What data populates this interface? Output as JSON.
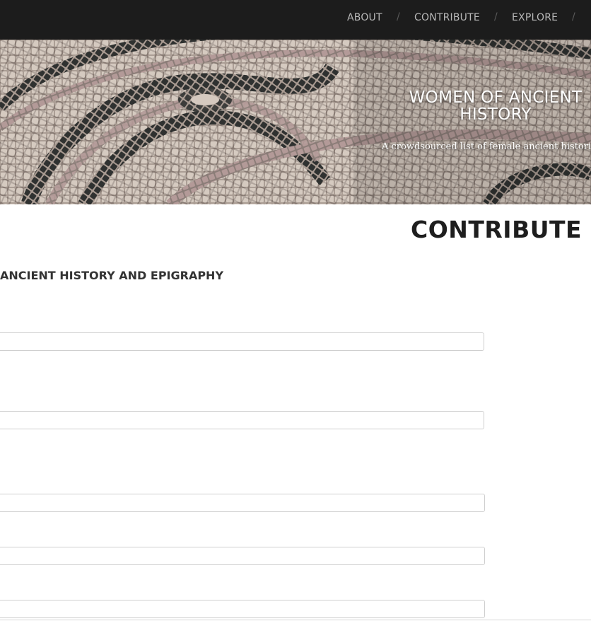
{
  "nav": {
    "items": [
      {
        "label": "ABOUT"
      },
      {
        "label": "CONTRIBUTE"
      },
      {
        "label": "EXPLORE"
      }
    ],
    "separator": "/"
  },
  "hero": {
    "title": "WOMEN OF ANCIENT\nHISTORY",
    "subtitle": "A crowdsourced list of female ancient historians"
  },
  "page": {
    "heading": "CONTRIBUTE",
    "section_title": "ANCIENT HISTORY AND EPIGRAPHY"
  },
  "form": {
    "fields": [
      {
        "value": ""
      },
      {
        "value": ""
      },
      {
        "value": ""
      },
      {
        "value": ""
      },
      {
        "value": ""
      }
    ]
  }
}
